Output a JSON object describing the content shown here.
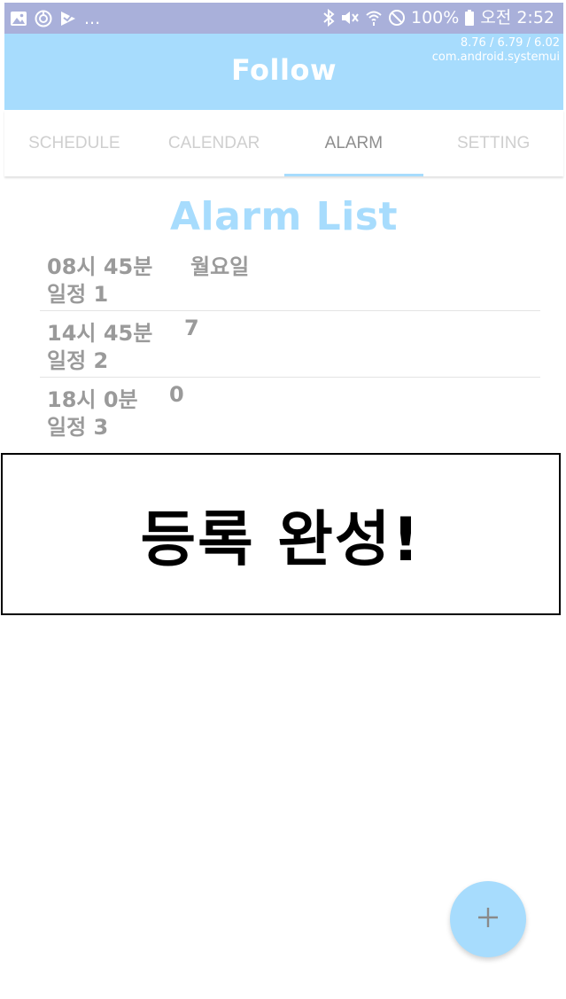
{
  "status_bar": {
    "left_icons": [
      "gallery-icon",
      "location-icon",
      "play-store-icon"
    ],
    "overflow": "...",
    "right_icons": [
      "bluetooth-icon",
      "mute-icon",
      "wifi-icon",
      "dnd-icon",
      "battery-icon"
    ],
    "battery": "100%",
    "time": "오전 2:52"
  },
  "debug": {
    "line1": "8.76 / 6.79 / 6.02",
    "line2": "com.android.systemui"
  },
  "header": {
    "title": "Follow"
  },
  "tabs": [
    {
      "label": "SCHEDULE",
      "active": false
    },
    {
      "label": "CALENDAR",
      "active": false
    },
    {
      "label": "ALARM",
      "active": true
    },
    {
      "label": "SETTING",
      "active": false
    }
  ],
  "alarm_list": {
    "title": "Alarm List",
    "items": [
      {
        "time": "08시 45분",
        "day": "월요일",
        "name": "일정 1"
      },
      {
        "time": "14시 45분",
        "day": "7",
        "name": "일정 2"
      },
      {
        "time": "18시 0분",
        "day": "0",
        "name": "일정 3"
      }
    ]
  },
  "toast": {
    "message": "등록 완성!"
  },
  "fab": {
    "icon": "plus-icon"
  },
  "colors": {
    "status_bar": "#a9b0da",
    "accent": "#a7dcfd",
    "tab_inactive": "#cfcfcf",
    "tab_active": "#8e8e8e",
    "list_text": "#9a9a9a"
  }
}
